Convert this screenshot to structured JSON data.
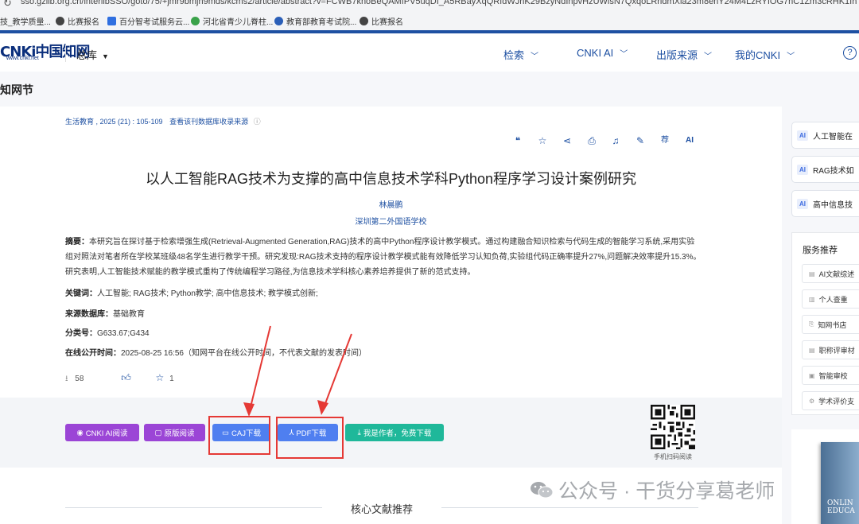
{
  "browser": {
    "url": "sso.gzlib.org.cn/interlibSSO/goto/75/+jmr9bmjh9mds/kcms2/article/abstract?v=FCWB7knoBeQAMfPV5uqDI_A5RBayXqQRfdWJhK29BzyNdInpvHzUWlsN7QxqoLRridmXia23m8enY24M4LzRYIOG7nC1Zm3cRHK1Ih",
    "bookmarks": [
      {
        "label": "技_教学质量..."
      },
      {
        "label": "比赛报名"
      },
      {
        "label": "百分智考试服务云..."
      },
      {
        "label": "河北省青少儿脊柱..."
      },
      {
        "label": "教育部教育考试院..."
      },
      {
        "label": "比赛报名"
      }
    ]
  },
  "header": {
    "logo_main": "CNKi中国知网",
    "logo_sub": "www.cnki.net",
    "library": "总库",
    "nav": [
      {
        "label": "检索"
      },
      {
        "label": "CNKI AI"
      },
      {
        "label": "出版来源"
      },
      {
        "label": "我的CNKI"
      }
    ],
    "help": "?"
  },
  "subtitle": "知网节",
  "article": {
    "source": "生活教育 , 2025 (21) : 105-109",
    "source_link": "查看该刊数据库收录来源",
    "title": "以人工智能RAG技术为支撑的高中信息技术学科Python程序学习设计案例研究",
    "author": "林晨鹏",
    "org": "深圳第二外国语学校",
    "abstract_label": "摘要：",
    "abstract": "本研究旨在探讨基于检索增强生成(Retrieval-Augmented Generation,RAG)技术的高中Python程序设计教学模式。通过构建融合知识检索与代码生成的智能学习系统,采用实验组对照法对笔者所在学校某班级48名学生进行教学干预。研究发现:RAG技术支持的程序设计教学模式能有效降低学习认知负荷,实验组代码正确率提升27%,问题解决效率提升15.3%。研究表明,人工智能技术赋能的教学模式重构了传统编程学习路径,为信息技术学科核心素养培养提供了新的范式支持。",
    "keywords_label": "关键词：",
    "keywords": "人工智能;  RAG技术;  Python教学;  高中信息技术;  教学模式创新;",
    "db_label": "来源数据库：",
    "db": "基础教育",
    "class_label": "分类号：",
    "class": "G633.67;G434",
    "pub_label": "在线公开时间：",
    "pub": "2025-08-25 16:56（知网平台在线公开时间，不代表文献的发表时间）",
    "downloads": "58",
    "favorites": "1"
  },
  "toolbar": {
    "icons": [
      "quote-icon",
      "star-icon",
      "share-icon",
      "print-icon",
      "bell-icon",
      "note-icon",
      "recommend-icon",
      "ai-icon"
    ],
    "recommend": "荐",
    "ai": "AI"
  },
  "downloads": {
    "cnki_ai": "CNKI AI阅读",
    "original": "原版阅读",
    "caj": "CAJ下载",
    "pdf": "PDF下载",
    "author_free": "我是作者，免费下载",
    "qr_label": "手机扫码阅读"
  },
  "recommend_title": "核心文献推荐",
  "sidebar": {
    "ai_items": [
      {
        "badge": "AI",
        "label": "人工智能在"
      },
      {
        "badge": "AI",
        "label": "RAG技术如"
      },
      {
        "badge": "AI",
        "label": "高中信息技"
      }
    ],
    "service_title": "服务推荐",
    "services": [
      {
        "label": "AI文献综述"
      },
      {
        "label": "个人查重"
      },
      {
        "label": "知网书店"
      },
      {
        "label": "职称评审材"
      },
      {
        "label": "智能审校"
      },
      {
        "label": "学术评价支"
      }
    ],
    "book_text": "ONLIN\nEDUCA"
  },
  "watermark": "公众号 · 干货分享葛老师",
  "colors": {
    "brand": "#1e50a2",
    "purple": "#9b45d6",
    "blue_btn": "#4f7ff0",
    "green_btn": "#1fb89a",
    "red_box": "#e53935"
  }
}
